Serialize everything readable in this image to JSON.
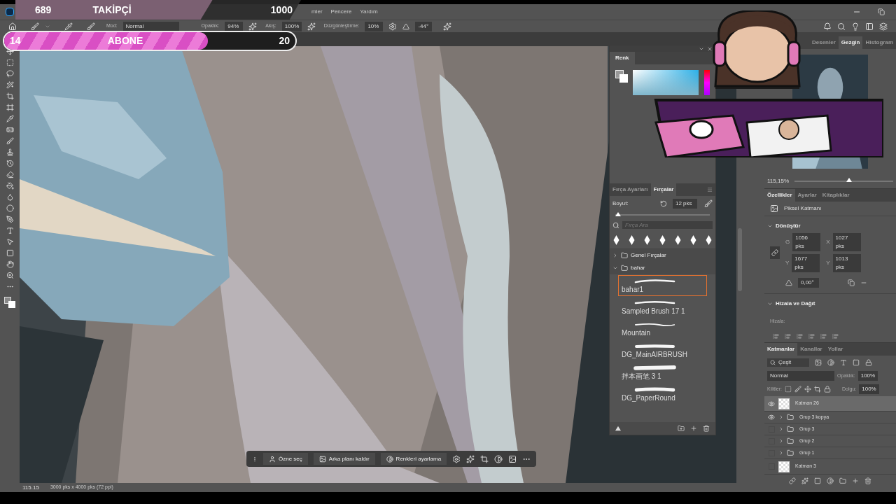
{
  "overlay": {
    "followers": {
      "current": "689",
      "label": "TAKİPÇİ",
      "goal": "1000",
      "level": 0.69
    },
    "subscribers": {
      "current": "14",
      "label": "ABONE",
      "goal": "20",
      "level": 0.7
    }
  },
  "menu": [
    "mler",
    "Pencere",
    "Yardım"
  ],
  "options_bar": {
    "mode_label": "Mod:",
    "mode": "Normal",
    "opacity_label": "Opaklık:",
    "opacity": "94%",
    "flow_label": "Akış:",
    "flow": "100%",
    "smoothing_label": "Düzgünleştirme:",
    "smoothing": "10%",
    "angle": "-44°"
  },
  "color_panel": {
    "tab": "Renk"
  },
  "brush_panel": {
    "tabs": [
      {
        "label": "Fırça Ayarları",
        "selected": false
      },
      {
        "label": "Fırçalar",
        "selected": true
      }
    ],
    "size_label": "Boyut:",
    "size": "12 pks",
    "size_slider": {
      "level": 0.03
    },
    "search_placeholder": "Fırça Ara",
    "folders": [
      {
        "name": "Genel Fırçalar",
        "expanded": false
      },
      {
        "name": "bahar",
        "expanded": true,
        "children": [
          {
            "name": "bahar1",
            "selected": true
          },
          {
            "name": "Sampled Brush 17 1",
            "selected": false
          },
          {
            "name": "Mountain",
            "selected": false
          },
          {
            "name": "DG_MainAIRBRUSH",
            "selected": false
          },
          {
            "name": "拌本画笔 3 1",
            "selected": false
          },
          {
            "name": "DG_PaperRound",
            "selected": false
          }
        ]
      }
    ]
  },
  "navigator": {
    "tabs": [
      {
        "label": "Desenler",
        "selected": false
      },
      {
        "label": "Gezgin",
        "selected": true
      },
      {
        "label": "Histogram",
        "selected": false
      }
    ],
    "zoom": "115,15%",
    "zoom_slider": {
      "level": 0.55
    }
  },
  "properties": {
    "tabs": [
      {
        "label": "Özellikler",
        "selected": true
      },
      {
        "label": "Ayarlar",
        "selected": false
      },
      {
        "label": "Kitaplıklar",
        "selected": false
      }
    ],
    "layer_type": "Piksel Katmanı",
    "transform_title": "Dönüştür",
    "fields": [
      {
        "label": "G",
        "value": "1056 pks"
      },
      {
        "label": "X",
        "value": "1027 pks"
      },
      {
        "label": "Y",
        "value": "1677 pks"
      },
      {
        "label": "Y",
        "value": "1013 pks"
      }
    ],
    "angle": "0,00°",
    "align_title": "Hizala ve Dağıt",
    "align_label": "Hizala:"
  },
  "layers": {
    "tabs": [
      {
        "label": "Katmanlar",
        "selected": true
      },
      {
        "label": "Kanallar",
        "selected": false
      },
      {
        "label": "Yollar",
        "selected": false
      }
    ],
    "filter": "Çeşit",
    "blend": "Normal",
    "opacity_label": "Opaklık:",
    "opacity": "100%",
    "lock_label": "Kilitler:",
    "fill_label": "Dolgu:",
    "fill": "100%",
    "items": [
      {
        "name": "Katman 26",
        "kind": "layer",
        "visible": true,
        "selected": true
      },
      {
        "name": "Grup 3 kopya",
        "kind": "group",
        "visible": true,
        "selected": false
      },
      {
        "name": "Grup 3",
        "kind": "group",
        "visible": false,
        "selected": false
      },
      {
        "name": "Grup 2",
        "kind": "group",
        "visible": false,
        "selected": false
      },
      {
        "name": "Grup 1",
        "kind": "group",
        "visible": false,
        "selected": false
      },
      {
        "name": "Katman 3",
        "kind": "layer",
        "visible": false,
        "selected": false
      }
    ]
  },
  "context_bar": [
    "Özne seç",
    "Arka planı kaldır",
    "Renkleri ayarlama"
  ],
  "status": {
    "zoom": "115.15",
    "document": "3000 pks x 4000 pks (72 ppi)"
  }
}
